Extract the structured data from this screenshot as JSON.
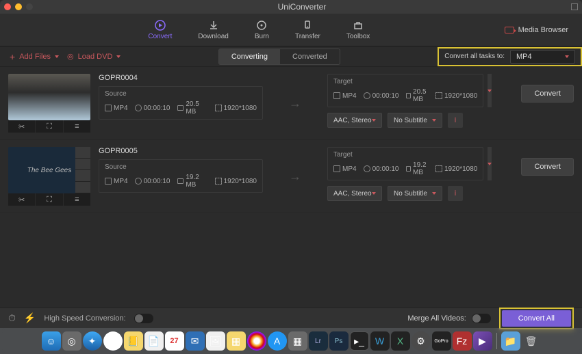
{
  "app": {
    "title": "UniConverter"
  },
  "nav": {
    "convert": "Convert",
    "download": "Download",
    "burn": "Burn",
    "transfer": "Transfer",
    "toolbox": "Toolbox",
    "media_browser": "Media Browser"
  },
  "subbar": {
    "add_files": "Add Files",
    "load_dvd": "Load DVD",
    "tab_converting": "Converting",
    "tab_converted": "Converted",
    "convert_all_to": "Convert all tasks to:",
    "format": "MP4"
  },
  "items": [
    {
      "name": "GOPR0004",
      "source": {
        "label": "Source",
        "format": "MP4",
        "duration": "00:00:10",
        "size": "20.5 MB",
        "resolution": "1920*1080"
      },
      "target": {
        "label": "Target",
        "format": "MP4",
        "duration": "00:00:10",
        "size": "20.5 MB",
        "resolution": "1920*1080"
      },
      "audio": "AAC, Stereo",
      "subtitle": "No Subtitle",
      "action": "Convert",
      "thumb_text": ""
    },
    {
      "name": "GOPR0005",
      "source": {
        "label": "Source",
        "format": "MP4",
        "duration": "00:00:10",
        "size": "19.2 MB",
        "resolution": "1920*1080"
      },
      "target": {
        "label": "Target",
        "format": "MP4",
        "duration": "00:00:10",
        "size": "19.2 MB",
        "resolution": "1920*1080"
      },
      "audio": "AAC, Stereo",
      "subtitle": "No Subtitle",
      "action": "Convert",
      "thumb_text": "The Bee Gees"
    }
  ],
  "bottom": {
    "high_speed": "High Speed Conversion:",
    "merge": "Merge All Videos:",
    "convert_all": "Convert All"
  },
  "dock": {
    "cal_day": "27",
    "lr": "Lr",
    "ps": "Ps",
    "w": "W",
    "x": "X",
    "gopro": "GoPro"
  }
}
